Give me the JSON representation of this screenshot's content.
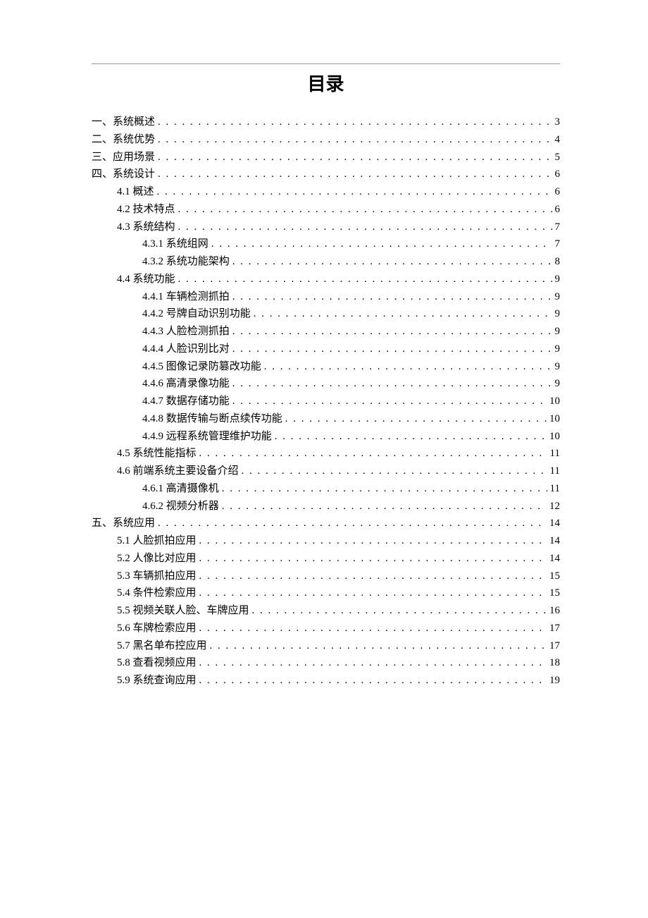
{
  "title": "目录",
  "toc": [
    {
      "indent": 0,
      "label": "一、系统概述",
      "page": "3"
    },
    {
      "indent": 0,
      "label": "二、系统优势",
      "page": "4"
    },
    {
      "indent": 0,
      "label": "三、应用场景",
      "page": "5"
    },
    {
      "indent": 0,
      "label": "四、系统设计",
      "page": "6"
    },
    {
      "indent": 1,
      "label": "4.1 概述",
      "page": "6"
    },
    {
      "indent": 1,
      "label": "4.2 技术特点",
      "page": "6"
    },
    {
      "indent": 1,
      "label": "4.3 系统结构",
      "page": "7"
    },
    {
      "indent": 2,
      "label": "4.3.1 系统组网",
      "page": "7"
    },
    {
      "indent": 2,
      "label": "4.3.2 系统功能架构",
      "page": "8"
    },
    {
      "indent": 1,
      "label": "4.4 系统功能",
      "page": "9"
    },
    {
      "indent": 2,
      "label": "4.4.1 车辆检测抓拍",
      "page": "9"
    },
    {
      "indent": 2,
      "label": "4.4.2  号牌自动识别功能",
      "page": "9"
    },
    {
      "indent": 2,
      "label": "4.4.3 人脸检测抓拍",
      "page": "9"
    },
    {
      "indent": 2,
      "label": "4.4.4 人脸识别比对",
      "page": "9"
    },
    {
      "indent": 2,
      "label": "4.4.5 图像记录防篡改功能",
      "page": "9"
    },
    {
      "indent": 2,
      "label": "4.4.6 高清录像功能",
      "page": "9"
    },
    {
      "indent": 2,
      "label": "4.4.7 数据存储功能",
      "page": "10"
    },
    {
      "indent": 2,
      "label": "4.4.8 数据传输与断点续传功能",
      "page": "10"
    },
    {
      "indent": 2,
      "label": "4.4.9 远程系统管理维护功能",
      "page": "10"
    },
    {
      "indent": 1,
      "label": "4.5  系统性能指标",
      "page": "11"
    },
    {
      "indent": 1,
      "label": "4.6 前端系统主要设备介绍",
      "page": "11"
    },
    {
      "indent": 2,
      "label": "4.6.1 高清摄像机",
      "page": "11"
    },
    {
      "indent": 2,
      "label": "4.6.2 视频分析器",
      "page": "12"
    },
    {
      "indent": 0,
      "label": "五、系统应用",
      "page": "14"
    },
    {
      "indent": 1,
      "label": "5.1 人脸抓拍应用",
      "page": "14"
    },
    {
      "indent": 1,
      "label": "5.2  人像比对应用",
      "page": "14"
    },
    {
      "indent": 1,
      "label": "5.3  车辆抓拍应用",
      "page": "15"
    },
    {
      "indent": 1,
      "label": "5.4  条件检索应用",
      "page": "15"
    },
    {
      "indent": 1,
      "label": "5.5 视频关联人脸、车牌应用",
      "page": "16"
    },
    {
      "indent": 1,
      "label": "5.6  车牌检索应用",
      "page": "17"
    },
    {
      "indent": 1,
      "label": "5.7  黑名单布控应用",
      "page": "17"
    },
    {
      "indent": 1,
      "label": "5.8  查看视频应用",
      "page": "18"
    },
    {
      "indent": 1,
      "label": "5.9  系统查询应用",
      "page": "19"
    }
  ]
}
